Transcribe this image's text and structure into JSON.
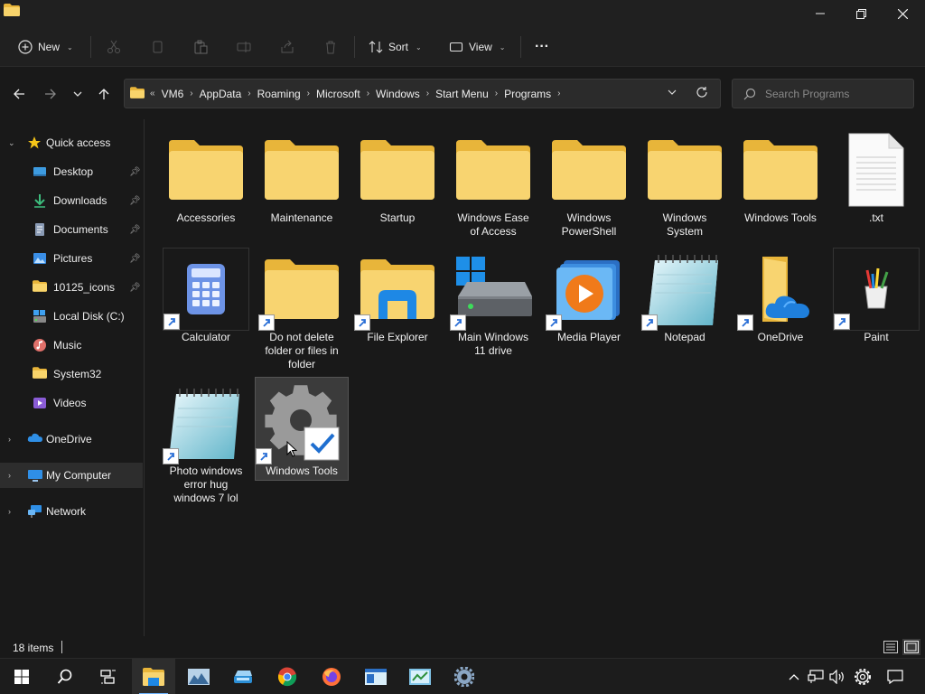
{
  "window": {
    "minimize_icon": "minimize-icon",
    "maximize_icon": "restore-icon",
    "close_icon": "close-icon"
  },
  "toolbar": {
    "new_label": "New",
    "sort_label": "Sort",
    "view_label": "View",
    "more_label": "···"
  },
  "address": {
    "overflow": "«",
    "crumbs": [
      "VM6",
      "AppData",
      "Roaming",
      "Microsoft",
      "Windows",
      "Start Menu",
      "Programs"
    ],
    "search_placeholder": "Search Programs"
  },
  "sidebar": {
    "quick_access": "Quick access",
    "items": [
      {
        "label": "Desktop",
        "pinned": true
      },
      {
        "label": "Downloads",
        "pinned": true
      },
      {
        "label": "Documents",
        "pinned": true
      },
      {
        "label": "Pictures",
        "pinned": true
      },
      {
        "label": "10125_icons",
        "pinned": true
      },
      {
        "label": "Local Disk (C:)",
        "pinned": false
      },
      {
        "label": "Music",
        "pinned": false
      },
      {
        "label": "System32",
        "pinned": false
      },
      {
        "label": "Videos",
        "pinned": false
      }
    ],
    "onedrive": "OneDrive",
    "my_computer": "My Computer",
    "network": "Network"
  },
  "files": [
    {
      "name": "Accessories",
      "icon": "folder-icon"
    },
    {
      "name": "Maintenance",
      "icon": "folder-icon"
    },
    {
      "name": "Startup",
      "icon": "folder-icon"
    },
    {
      "name": "Windows Ease of Access",
      "icon": "folder-icon"
    },
    {
      "name": "Windows PowerShell",
      "icon": "folder-icon"
    },
    {
      "name": "Windows System",
      "icon": "folder-icon"
    },
    {
      "name": "Windows Tools",
      "icon": "folder-icon"
    },
    {
      "name": ".txt",
      "icon": "text-file-icon"
    },
    {
      "name": "Calculator",
      "icon": "calculator-icon"
    },
    {
      "name": "Do not delete folder or files in folder",
      "icon": "folder-shortcut-icon"
    },
    {
      "name": "File Explorer",
      "icon": "file-explorer-icon"
    },
    {
      "name": "Main Windows 11 drive",
      "icon": "drive-icon"
    },
    {
      "name": "Media Player",
      "icon": "media-player-icon"
    },
    {
      "name": "Notepad",
      "icon": "notepad-icon"
    },
    {
      "name": "OneDrive",
      "icon": "onedrive-folder-icon"
    },
    {
      "name": "Paint",
      "icon": "paint-icon"
    },
    {
      "name": "Photo windows error hug windows 7 lol",
      "icon": "notepad-icon"
    },
    {
      "name": "Windows Tools",
      "icon": "settings-gear-icon"
    }
  ],
  "status": {
    "item_count": "18 items"
  },
  "taskbar": {
    "apps": [
      "start-icon",
      "search-icon",
      "task-view-icon",
      "file-explorer-icon",
      "photos-icon",
      "disk-app-icon",
      "chrome-icon",
      "firefox-icon",
      "notepad-app-icon",
      "control-panel-icon",
      "settings-icon"
    ]
  },
  "colors": {
    "folder": "#f4c94f",
    "accent": "#4cc2ff",
    "background": "#191919"
  }
}
